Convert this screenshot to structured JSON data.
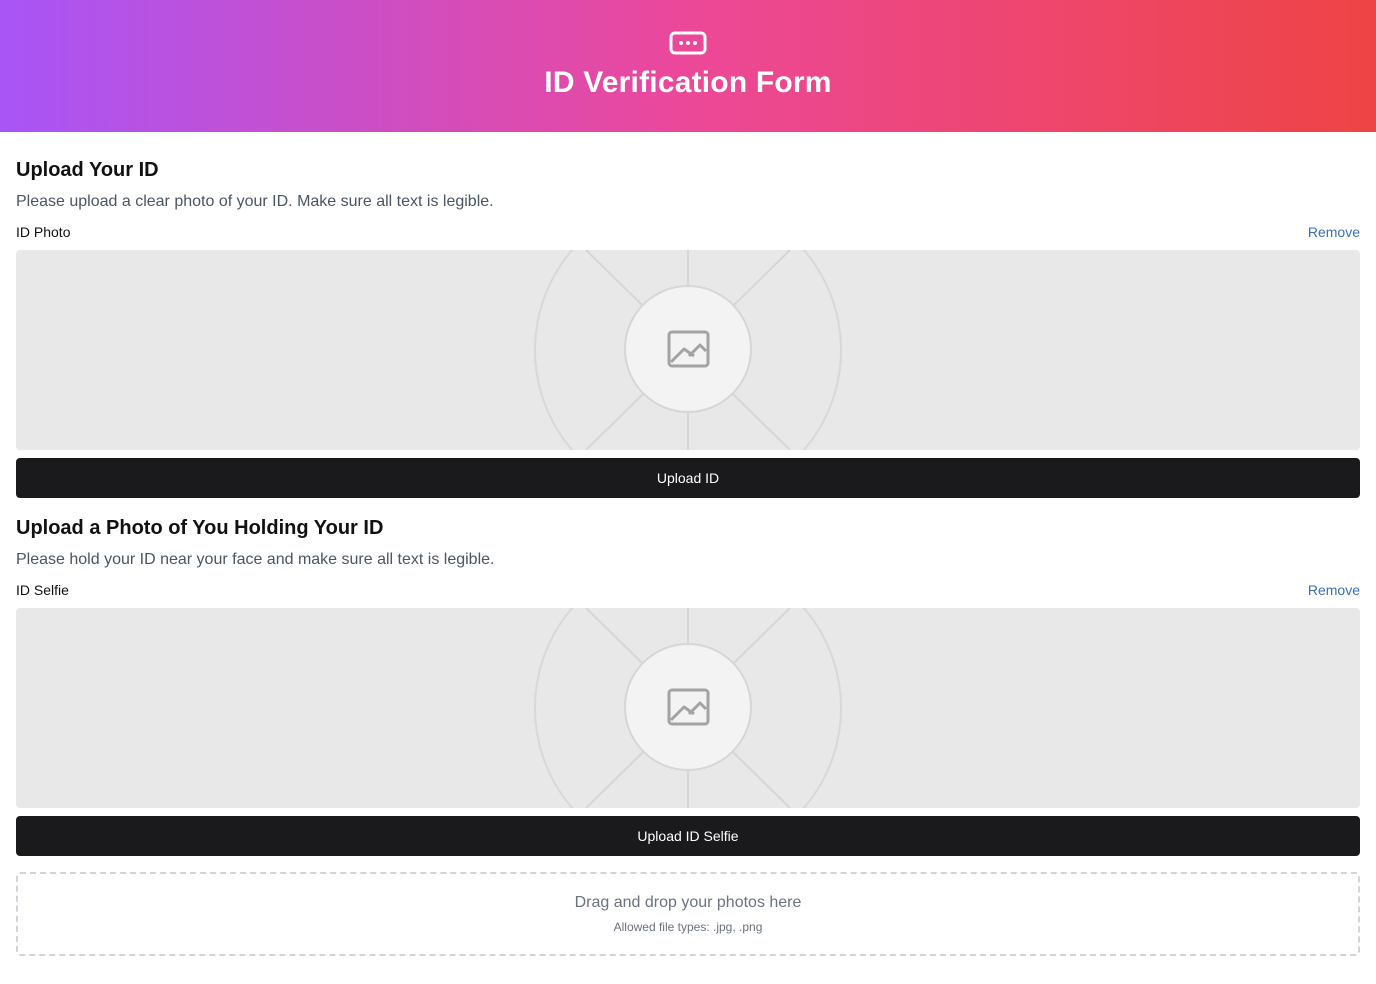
{
  "header": {
    "icon": "ellipsis-card-icon",
    "title": "ID Verification Form",
    "gradient": [
      "#a855f7",
      "#ec4899",
      "#ef4444"
    ]
  },
  "sections": [
    {
      "title": "Upload Your ID",
      "description": "Please upload a clear photo of your ID. Make sure all text is legible.",
      "field_label": "ID Photo",
      "remove_label": "Remove",
      "placeholder_icon": "image-placeholder-icon",
      "button_label": "Upload ID"
    },
    {
      "title": "Upload a Photo of You Holding Your ID",
      "description": "Please hold your ID near your face and make sure all text is legible.",
      "field_label": "ID Selfie",
      "remove_label": "Remove",
      "placeholder_icon": "image-placeholder-icon",
      "button_label": "Upload ID Selfie"
    }
  ],
  "dropzone": {
    "main_text": "Drag and drop your photos here",
    "sub_text": "Allowed file types: .jpg, .png"
  },
  "colors": {
    "button_bg": "#1a1a1d",
    "link": "#3b6fb6",
    "placeholder_bg": "#e8e8e8"
  }
}
